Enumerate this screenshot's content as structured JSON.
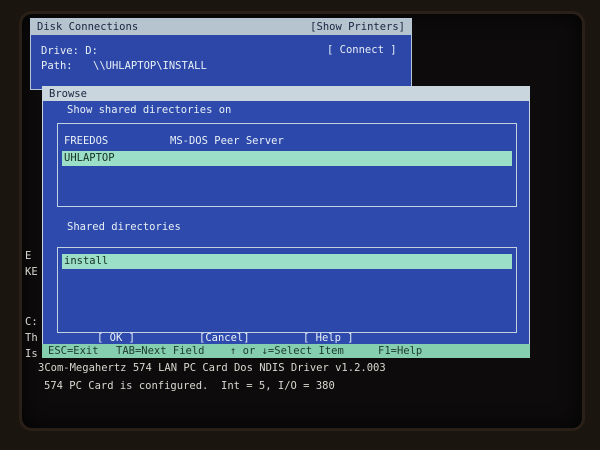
{
  "disk_window": {
    "title": "Disk Connections",
    "printers_button": "[Show Printers]",
    "drive_label": "Drive: D:",
    "path_label": "Path:",
    "path_value": "\\\\UHLAPTOP\\INSTALL",
    "connect_button": "[ Connect ]"
  },
  "browse_window": {
    "title": "Browse",
    "servers_label": "Show shared directories on",
    "servers": [
      {
        "name": "FREEDOS",
        "comment": "MS-DOS Peer Server",
        "selected": false
      },
      {
        "name": "UHLAPTOP",
        "comment": "",
        "selected": true
      }
    ],
    "shares_label": "Shared directories",
    "shares": [
      {
        "name": "install",
        "selected": true
      }
    ],
    "ok_button": "[ OK ]",
    "cancel_button": "[Cancel]",
    "help_button": "[ Help ]"
  },
  "status_bar": {
    "esc": "ESC=Exit",
    "tab": "TAB=Next Field",
    "arrows": "↑ or ↓=Select Item",
    "f1": "F1=Help"
  },
  "left_fragments": {
    "e": "E",
    "ke": "KE",
    "c": "C:",
    "th": "Th",
    "is": "Is"
  },
  "dos_output": {
    "line1": "3Com-Megahertz 574 LAN PC Card Dos NDIS Driver v1.2.003",
    "line2": "574 PC Card is configured.  Int = 5, I/O = 380"
  },
  "colors": {
    "window_blue": "#2d4aac",
    "selection_green": "#9bdfc9",
    "status_green": "#86cfae",
    "titlebar_grey": "#c9d6de"
  }
}
